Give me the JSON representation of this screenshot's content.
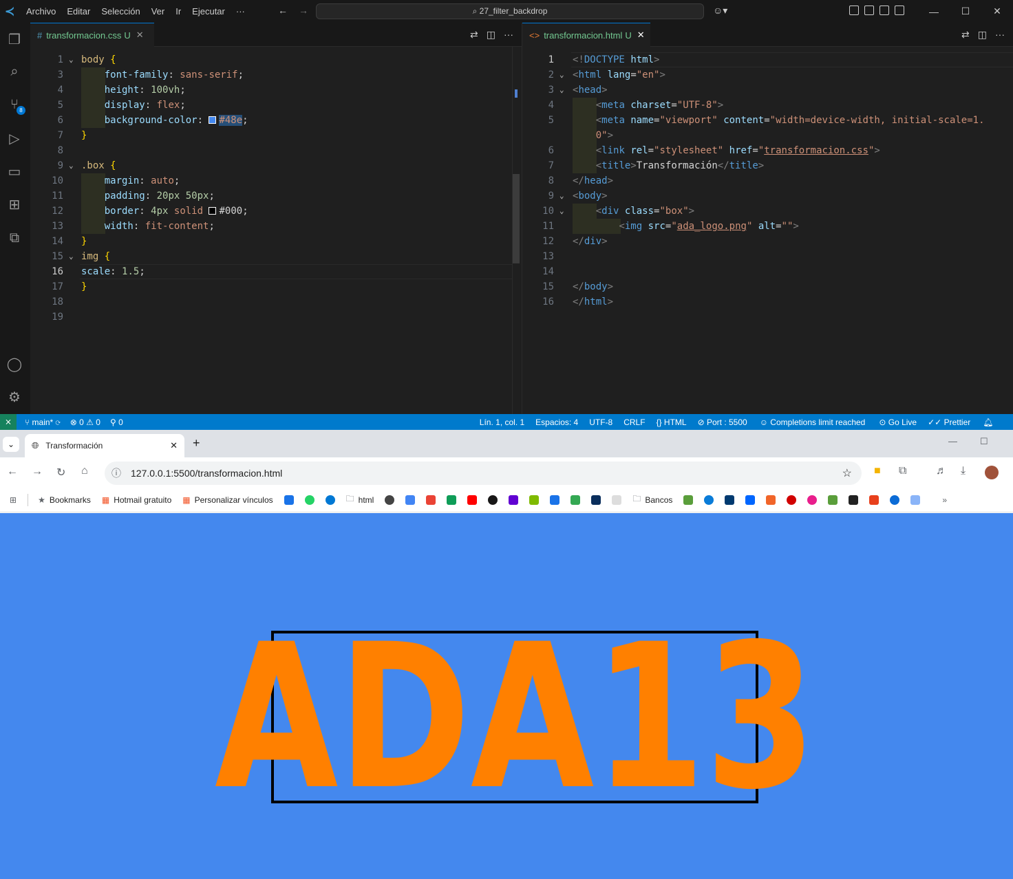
{
  "titlebar": {
    "menu": [
      "Archivo",
      "Editar",
      "Selección",
      "Ver",
      "Ir",
      "Ejecutar",
      "···"
    ],
    "search": "27_filter_backdrop"
  },
  "left_editor": {
    "tab": {
      "name": "transformacion.css",
      "status": "U",
      "icon": "#"
    },
    "lines": [
      {
        "n": "1",
        "html": "<span class='k'>body</span> <span class='b'>{</span>",
        "fold": true
      },
      {
        "n": "3",
        "html": "    <span class='p'>font-family</span><span class='w'>: </span><span class='v'>sans-serif</span><span class='w'>;</span>"
      },
      {
        "n": "4",
        "html": "    <span class='p'>height</span><span class='w'>: </span><span class='n'>100vh</span><span class='w'>;</span>"
      },
      {
        "n": "5",
        "html": "    <span class='p'>display</span><span class='w'>: </span><span class='v'>flex</span><span class='w'>;</span>"
      },
      {
        "n": "6",
        "html": "    <span class='p'>background-color</span><span class='w'>: </span><span class='sw' style='background:#4488ee'></span><span class='v hl'>#48e</span><span class='w'>;</span>"
      },
      {
        "n": "7",
        "html": "<span class='b'>}</span>"
      },
      {
        "n": "8",
        "html": ""
      },
      {
        "n": "9",
        "html": "<span class='k'>.box</span> <span class='b'>{</span>",
        "fold": true
      },
      {
        "n": "10",
        "html": "    <span class='p'>margin</span><span class='w'>: </span><span class='v'>auto</span><span class='w'>;</span>"
      },
      {
        "n": "11",
        "html": "    <span class='p'>padding</span><span class='w'>: </span><span class='n'>20px 50px</span><span class='w'>;</span>"
      },
      {
        "n": "12",
        "html": "    <span class='p'>border</span><span class='w'>: </span><span class='n'>4px</span> <span class='v'>solid</span> <span class='sw' style='background:#000'></span><span class='w'>#000</span><span class='w'>;</span>"
      },
      {
        "n": "13",
        "html": "    <span class='p'>width</span><span class='w'>: </span><span class='v'>fit-content</span><span class='w'>;</span>"
      },
      {
        "n": "14",
        "html": "<span class='b'>}</span>"
      },
      {
        "n": "15",
        "html": "<span class='k'>img</span> <span class='b'>{</span>",
        "fold": true
      },
      {
        "n": "16",
        "html": "<span class='p'>scale</span><span class='w'>: </span><span class='n'>1.5</span><span class='w'>;</span>",
        "current": true
      },
      {
        "n": "17",
        "html": "<span class='b'>}</span>"
      },
      {
        "n": "18",
        "html": ""
      },
      {
        "n": "19",
        "html": ""
      }
    ]
  },
  "right_editor": {
    "tab": {
      "name": "transformacion.html",
      "status": "U",
      "icon": "<>"
    },
    "lines": [
      {
        "n": "1",
        "html": "<span class='g'>&lt;!</span><span class='t'>DOCTYPE</span> <span class='a'>html</span><span class='g'>&gt;</span>",
        "current": true
      },
      {
        "n": "2",
        "html": "<span class='g'>&lt;</span><span class='t'>html</span> <span class='a'>lang</span><span class='w'>=</span><span class='v'>\"en\"</span><span class='g'>&gt;</span>",
        "fold": true
      },
      {
        "n": "3",
        "html": "<span class='g'>&lt;</span><span class='t'>head</span><span class='g'>&gt;</span>",
        "fold": true
      },
      {
        "n": "4",
        "html": "    <span class='g'>&lt;</span><span class='t'>meta</span> <span class='a'>charset</span><span class='w'>=</span><span class='v'>\"UTF-8\"</span><span class='g'>&gt;</span>"
      },
      {
        "n": "5",
        "html": "    <span class='g'>&lt;</span><span class='t'>meta</span> <span class='a'>name</span><span class='w'>=</span><span class='v'>\"viewport\"</span> <span class='a'>content</span><span class='w'>=</span><span class='v'>\"width=device-width, initial-scale=1.</span>"
      },
      {
        "n": "",
        "html": "    <span class='v'>0\"</span><span class='g'>&gt;</span>"
      },
      {
        "n": "6",
        "html": "    <span class='g'>&lt;</span><span class='t'>link</span> <span class='a'>rel</span><span class='w'>=</span><span class='v'>\"stylesheet\"</span> <span class='a'>href</span><span class='w'>=</span><span class='v'>\"<u>transformacion.css</u>\"</span><span class='g'>&gt;</span>"
      },
      {
        "n": "7",
        "html": "    <span class='g'>&lt;</span><span class='t'>title</span><span class='g'>&gt;</span><span class='w'>Transformación</span><span class='g'>&lt;/</span><span class='t'>title</span><span class='g'>&gt;</span>"
      },
      {
        "n": "8",
        "html": "<span class='g'>&lt;/</span><span class='t'>head</span><span class='g'>&gt;</span>"
      },
      {
        "n": "9",
        "html": "<span class='g'>&lt;</span><span class='t'>body</span><span class='g'>&gt;</span>",
        "fold": true
      },
      {
        "n": "10",
        "html": "    <span class='g'>&lt;</span><span class='t'>div</span> <span class='a'>class</span><span class='w'>=</span><span class='v'>\"box\"</span><span class='g'>&gt;</span>",
        "fold": true
      },
      {
        "n": "11",
        "html": "        <span class='g'>&lt;</span><span class='t'>img</span> <span class='a'>src</span><span class='w'>=</span><span class='v'>\"<u>ada_logo.png</u>\"</span> <span class='a'>alt</span><span class='w'>=</span><span class='v'>\"\"</span><span class='g'>&gt;</span>"
      },
      {
        "n": "12",
        "html": "<span class='g'>&lt;/</span><span class='t'>div</span><span class='g'>&gt;</span>"
      },
      {
        "n": "13",
        "html": ""
      },
      {
        "n": "14",
        "html": ""
      },
      {
        "n": "15",
        "html": "<span class='g'>&lt;/</span><span class='t'>body</span><span class='g'>&gt;</span>"
      },
      {
        "n": "16",
        "html": "<span class='g'>&lt;/</span><span class='t'>html</span><span class='g'>&gt;</span>"
      }
    ]
  },
  "statusbar": {
    "branch": "main*",
    "errors": "0",
    "warnings": "0",
    "ports": "0",
    "position": "Lín. 1, col. 1",
    "spaces": "Espacios: 4",
    "encoding": "UTF-8",
    "eol": "CRLF",
    "language": "HTML",
    "port": "Port : 5500",
    "completions": "Completions limit reached",
    "golive": "Go Live",
    "prettier": "Prettier"
  },
  "browser": {
    "tab_title": "Transformación",
    "url": "127.0.0.1:5500/transformacion.html",
    "bookmarks": [
      "Bookmarks",
      "Hotmail gratuito",
      "Personalizar vínculos",
      "html",
      "Bancos"
    ],
    "logo_text": "ADA13",
    "page_bg": "#4488ee",
    "logo_color": "#ff8000"
  }
}
